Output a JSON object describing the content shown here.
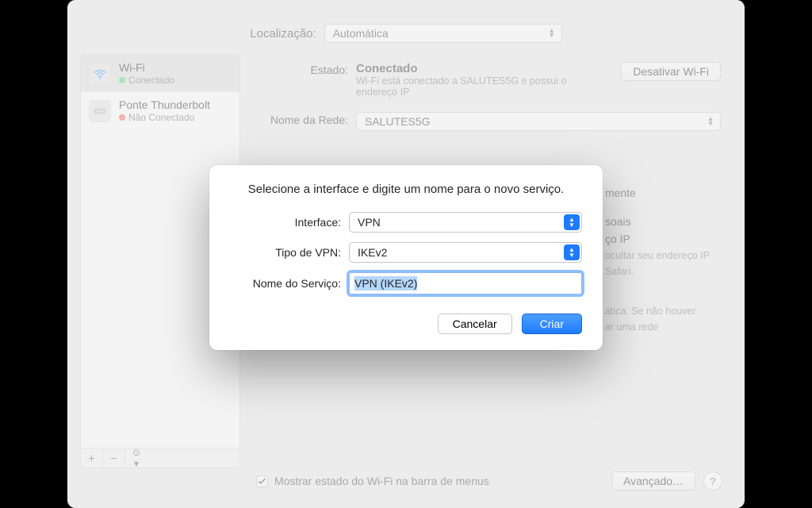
{
  "location": {
    "label": "Localização:",
    "value": "Automática"
  },
  "sidebar": {
    "items": [
      {
        "name": "Wi-Fi",
        "status": "Conectado",
        "state": "green"
      },
      {
        "name": "Ponte Thunderbolt",
        "status": "Não Conectado",
        "state": "red"
      }
    ],
    "footer": {
      "plus": "+",
      "minus": "−",
      "gear": "☺︎"
    }
  },
  "main": {
    "status_label": "Estado:",
    "status_value": "Conectado",
    "disable_button": "Desativar Wi-Fi",
    "status_desc": "Wi-Fi está conectado a SALUTES5G e possui o endereço IP",
    "network_label": "Nome da Rede:",
    "network_value": "SALUTES5G",
    "partial_lines": [
      "mente",
      "soais",
      "ço IP",
      "ocultar seu endereço IP",
      "Safari.",
      "ática. Se não houver",
      "ar uma rede"
    ],
    "show_status_checkbox": "Mostrar estado do Wi-Fi na barra de menus",
    "advanced_button": "Avançado…",
    "help": "?"
  },
  "dialog": {
    "title": "Selecione a interface e digite um nome para o novo serviço.",
    "rows": {
      "interface": {
        "label": "Interface:",
        "value": "VPN"
      },
      "vpn_type": {
        "label": "Tipo de VPN:",
        "value": "IKEv2"
      },
      "service": {
        "label": "Nome do Serviço:",
        "value": "VPN (IKEv2)"
      }
    },
    "buttons": {
      "cancel": "Cancelar",
      "create": "Criar"
    }
  }
}
